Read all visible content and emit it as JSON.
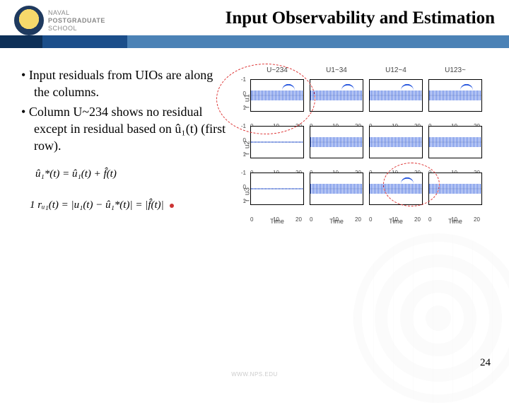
{
  "header": {
    "inst_line1": "NAVAL",
    "inst_line2": "POSTGRADUATE",
    "inst_line3": "SCHOOL",
    "title": "Input Observability and Estimation"
  },
  "bullets": {
    "b1": "Input residuals from UIOs are along the columns.",
    "b2": "Column U~234 shows no residual except in residual based on û₁(t) (first row)."
  },
  "equations": {
    "eq1": "û₁*(t) = û₁(t) + f̂(t)",
    "eq2": "rᵤ₁(t) = |u₁(t) − û₁*(t)| = |f̂(t)|",
    "num1": "1"
  },
  "footer": {
    "url": "WWW.NPS.EDU",
    "page": "24"
  },
  "chart_data": {
    "type": "line",
    "layout": "4x3 grid of signal subplots",
    "columns": [
      "U~234",
      "U1~34",
      "U12~4",
      "U123~"
    ],
    "rows": [
      "r_u1",
      "r_u2",
      "r_u3"
    ],
    "xlabel": "Time",
    "xlim": [
      0,
      20
    ],
    "xticks": [
      0,
      10,
      20
    ],
    "ylim": [
      -1,
      1
    ],
    "yticks": [
      -1,
      0,
      1
    ],
    "x": [
      0,
      2,
      4,
      6,
      8,
      10,
      12,
      14,
      16,
      18,
      20
    ],
    "description": "Blue noisy residual signals centered near zero; a transient bump appears in some panels indicating residual response to the withheld input.",
    "panels": [
      {
        "row": "r_u1",
        "col": "U~234",
        "values": [
          0,
          0,
          0.05,
          0,
          0.05,
          0,
          0.6,
          0.9,
          0.5,
          0.1,
          0
        ],
        "bump": true,
        "flat": false,
        "circled": true
      },
      {
        "row": "r_u1",
        "col": "U1~34",
        "values": [
          0,
          0.05,
          0,
          0.05,
          0,
          0.1,
          0.55,
          0.85,
          0.45,
          0.05,
          0
        ],
        "bump": true,
        "flat": false
      },
      {
        "row": "r_u1",
        "col": "U12~4",
        "values": [
          0,
          0,
          0.05,
          0,
          0,
          0.05,
          0.5,
          0.8,
          0.4,
          0.05,
          0
        ],
        "bump": true,
        "flat": false
      },
      {
        "row": "r_u1",
        "col": "U123~",
        "values": [
          0,
          0.05,
          0,
          0,
          0.05,
          0,
          0.45,
          0.75,
          0.35,
          0.05,
          0
        ],
        "bump": true,
        "flat": false
      },
      {
        "row": "r_u2",
        "col": "U~234",
        "values": [
          0,
          0,
          0,
          0,
          0,
          0,
          0,
          0,
          0,
          0,
          0
        ],
        "bump": false,
        "flat": true
      },
      {
        "row": "r_u2",
        "col": "U1~34",
        "values": [
          0,
          0.05,
          0,
          0,
          0.05,
          0,
          0.1,
          0.1,
          0.05,
          0,
          0
        ],
        "bump": false,
        "flat": false
      },
      {
        "row": "r_u2",
        "col": "U12~4",
        "values": [
          0,
          0,
          0.05,
          0,
          0,
          0,
          0.1,
          0.05,
          0.05,
          0,
          0
        ],
        "bump": false,
        "flat": false
      },
      {
        "row": "r_u2",
        "col": "U123~",
        "values": [
          0,
          0,
          0,
          0.05,
          0,
          0.05,
          0.1,
          0.1,
          0.05,
          0,
          0
        ],
        "bump": false,
        "flat": false
      },
      {
        "row": "r_u3",
        "col": "U~234",
        "values": [
          0,
          0,
          0,
          0,
          0,
          0,
          0,
          0,
          0,
          0,
          0
        ],
        "bump": false,
        "flat": true
      },
      {
        "row": "r_u3",
        "col": "U1~34",
        "values": [
          0,
          0,
          0.05,
          0,
          0,
          0.05,
          0.05,
          0.1,
          0.05,
          0,
          0
        ],
        "bump": false,
        "flat": false
      },
      {
        "row": "r_u3",
        "col": "U12~4",
        "values": [
          0,
          0.05,
          0,
          0.05,
          0,
          0,
          0.5,
          0.75,
          0.35,
          0.05,
          0
        ],
        "bump": true,
        "flat": false,
        "circled": true
      },
      {
        "row": "r_u3",
        "col": "U123~",
        "values": [
          0,
          0,
          0,
          0,
          0.05,
          0,
          0.1,
          0.05,
          0.05,
          0,
          0
        ],
        "bump": false,
        "flat": false
      }
    ]
  }
}
